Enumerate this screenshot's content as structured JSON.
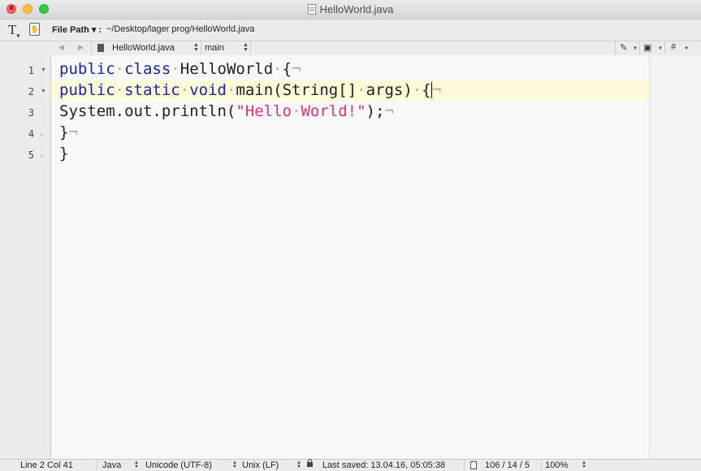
{
  "window": {
    "title": "HelloWorld.java"
  },
  "toolbar": {
    "text_tool_icon": "T",
    "file_path_label": "File Path ▾ :",
    "file_path_value": "~/Desktop/lager prog/HelloWorld.java"
  },
  "navbar": {
    "back_icon": "◀",
    "forward_icon": "▶",
    "file_name": "HelloWorld.java",
    "symbol": "main",
    "pen_icon": "✎",
    "doc_tool_icon": "▣",
    "hash_icon": "#"
  },
  "editor": {
    "line_numbers": [
      "1",
      "2",
      "3",
      "4",
      "5"
    ],
    "current_line": 2,
    "lines": [
      [
        {
          "t": "public",
          "c": "kw"
        },
        {
          "t": "·",
          "c": "ws"
        },
        {
          "t": "class",
          "c": "kw"
        },
        {
          "t": "·",
          "c": "ws"
        },
        {
          "t": "HelloWorld",
          "c": ""
        },
        {
          "t": "·",
          "c": "ws"
        },
        {
          "t": "{",
          "c": ""
        },
        {
          "t": "¬",
          "c": "ws"
        }
      ],
      [
        {
          "t": "public",
          "c": "kw"
        },
        {
          "t": "·",
          "c": "ws"
        },
        {
          "t": "static",
          "c": "kw"
        },
        {
          "t": "·",
          "c": "ws"
        },
        {
          "t": "void",
          "c": "kw"
        },
        {
          "t": "·",
          "c": "ws"
        },
        {
          "t": "main(String[]",
          "c": ""
        },
        {
          "t": "·",
          "c": "ws"
        },
        {
          "t": "args)",
          "c": ""
        },
        {
          "t": "·",
          "c": "ws"
        },
        {
          "t": "{",
          "c": ""
        },
        {
          "t": "",
          "c": "caret"
        },
        {
          "t": "¬",
          "c": "ws"
        }
      ],
      [
        {
          "t": "System.out.println(",
          "c": ""
        },
        {
          "t": "\"Hello",
          "c": "str"
        },
        {
          "t": "·",
          "c": "ws"
        },
        {
          "t": "World!\"",
          "c": "str"
        },
        {
          "t": ");",
          "c": ""
        },
        {
          "t": "¬",
          "c": "ws"
        }
      ],
      [
        {
          "t": "}",
          "c": ""
        },
        {
          "t": "¬",
          "c": "ws"
        }
      ],
      [
        {
          "t": "}",
          "c": ""
        }
      ]
    ]
  },
  "statusbar": {
    "position": "Line 2 Col 41",
    "syntax": "Java",
    "encoding": "Unicode (UTF-8)",
    "line_endings": "Unix (LF)",
    "last_saved": "Last saved: 13.04.16, 05:05:38",
    "doc_stats": "106 / 14 / 5",
    "zoom": "100%"
  },
  "colors": {
    "keyword": "#1a24a6",
    "string": "#e2336f",
    "invisible": "#a8a8a8",
    "current_line": "#fdfad8",
    "editor_bg": "#f8f8f8"
  }
}
